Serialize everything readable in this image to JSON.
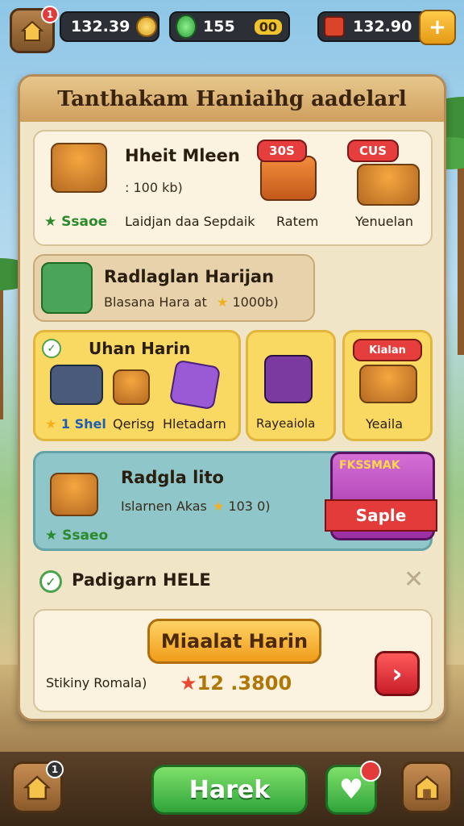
{
  "topbar": {
    "home_badge": "1",
    "coins": "132.39",
    "gems": "155",
    "gems_suffix": "00",
    "tickets": "132.90"
  },
  "panel": {
    "title": "Tanthakam Haniaihg aadelarl",
    "card1": {
      "title": "Hheit Mleen",
      "price": ": 100 kb)",
      "badge": "Ssaoe",
      "item1_label": "Laidjan daa Sepdaik",
      "item2_sign": "30S",
      "item2_label": "Ratem",
      "item3_sign": "CUS",
      "item3_label": "Yenuelan"
    },
    "card2": {
      "title": "Radlaglan Harijan",
      "subtitle": "Blasana Hara at",
      "value": "1000b)"
    },
    "card3": {
      "title": "Uhan Harin",
      "value": "1 Shel",
      "label2": "Qerisg",
      "label3": "Hletadarn"
    },
    "card4": {
      "label": "Rayeaiola"
    },
    "card5": {
      "sign": "Kialan",
      "label": "Yeaila"
    },
    "card6": {
      "title": "Radgla lito",
      "subtitle": "Islarnen Akas",
      "value": "103 0)",
      "badge": "Ssaeo",
      "sale_top": "FKSSMAK",
      "sale_label": "Saple"
    },
    "checkbox_label": "Padigarn HELE",
    "card7": {
      "button_label": "Miaalat Harin",
      "footer_label": "Stikiny Romala)",
      "footer_value": "12 .3800"
    }
  },
  "bottombar": {
    "home_badge": "1",
    "main_button": "Harek"
  }
}
